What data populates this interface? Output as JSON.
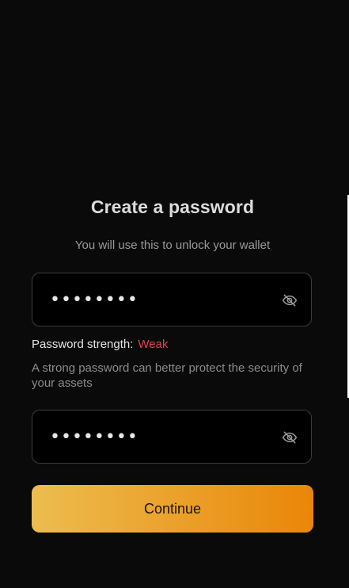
{
  "header": {
    "title": "Create a password",
    "subtitle": "You will use this to unlock your wallet"
  },
  "password_field": {
    "value": "••••••••",
    "icon": "eye-off-icon"
  },
  "strength": {
    "label": "Password strength:",
    "value": "Weak",
    "value_color": "#e0434d"
  },
  "hint": "A strong password can better protect the security of your assets",
  "confirm_field": {
    "value": "••••••••",
    "icon": "eye-off-icon"
  },
  "continue_button": {
    "label": "Continue",
    "gradient_start": "#ecbd4f",
    "gradient_end": "#ea8608"
  }
}
